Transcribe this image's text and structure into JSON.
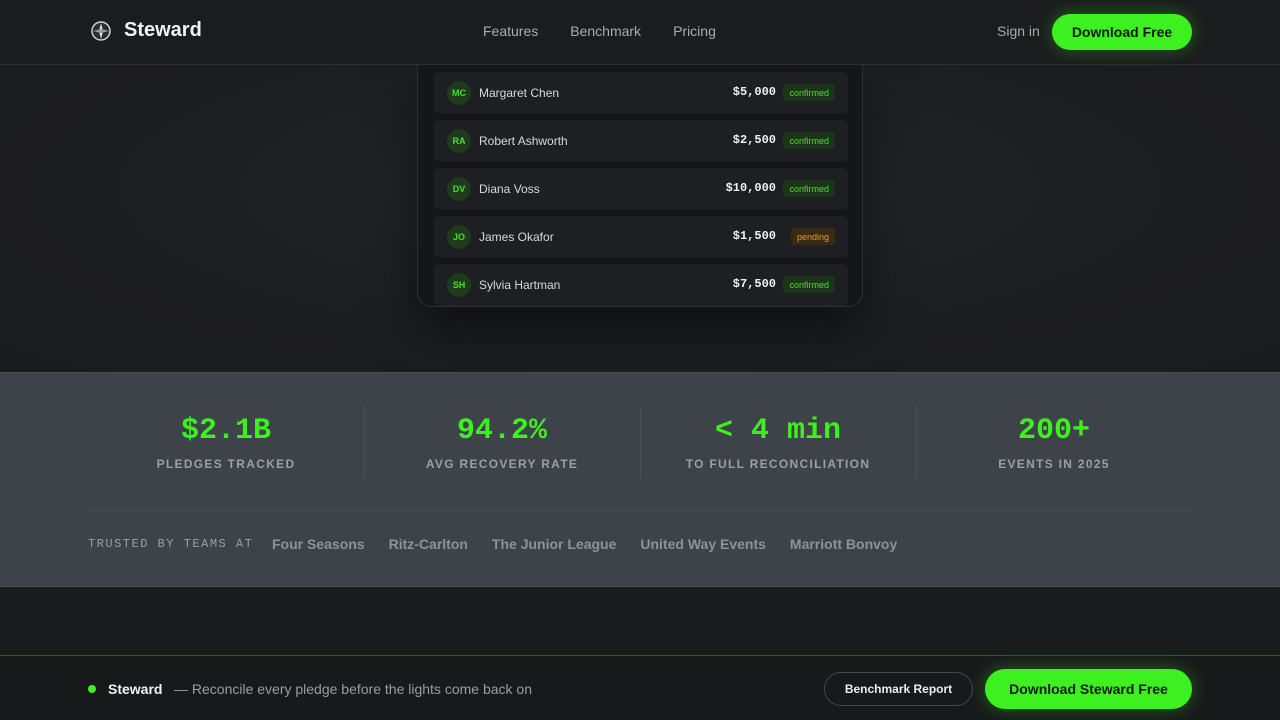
{
  "header": {
    "brand": "Steward",
    "nav": [
      "Features",
      "Benchmark",
      "Pricing"
    ],
    "signin": "Sign in",
    "cta": "Download Free"
  },
  "pledges": [
    {
      "initials": "MC",
      "name": "Margaret Chen",
      "amount": "$5,000",
      "status": "confirmed"
    },
    {
      "initials": "RA",
      "name": "Robert Ashworth",
      "amount": "$2,500",
      "status": "confirmed"
    },
    {
      "initials": "DV",
      "name": "Diana Voss",
      "amount": "$10,000",
      "status": "confirmed"
    },
    {
      "initials": "JO",
      "name": "James Okafor",
      "amount": "$1,500",
      "status": "pending"
    },
    {
      "initials": "SH",
      "name": "Sylvia Hartman",
      "amount": "$7,500",
      "status": "confirmed"
    }
  ],
  "stats": [
    {
      "value": "$2.1B",
      "label": "PLEDGES TRACKED"
    },
    {
      "value": "94.2%",
      "label": "AVG RECOVERY RATE"
    },
    {
      "value": "< 4 min",
      "label": "TO FULL RECONCILIATION"
    },
    {
      "value": "200+",
      "label": "EVENTS IN 2025"
    }
  ],
  "trusted": {
    "label": "TRUSTED BY TEAMS AT",
    "logos": [
      "Four Seasons",
      "Ritz-Carlton",
      "The Junior League",
      "United Way Events",
      "Marriott Bonvoy"
    ]
  },
  "bottombar": {
    "brand": "Steward",
    "tagline": "— Reconcile every pledge before the lights come back on",
    "secondary": "Benchmark Report",
    "primary": "Download Steward Free"
  },
  "colors": {
    "accent": "#3df01f",
    "pending": "#e09a3a",
    "stats_band": "#3e4249"
  }
}
